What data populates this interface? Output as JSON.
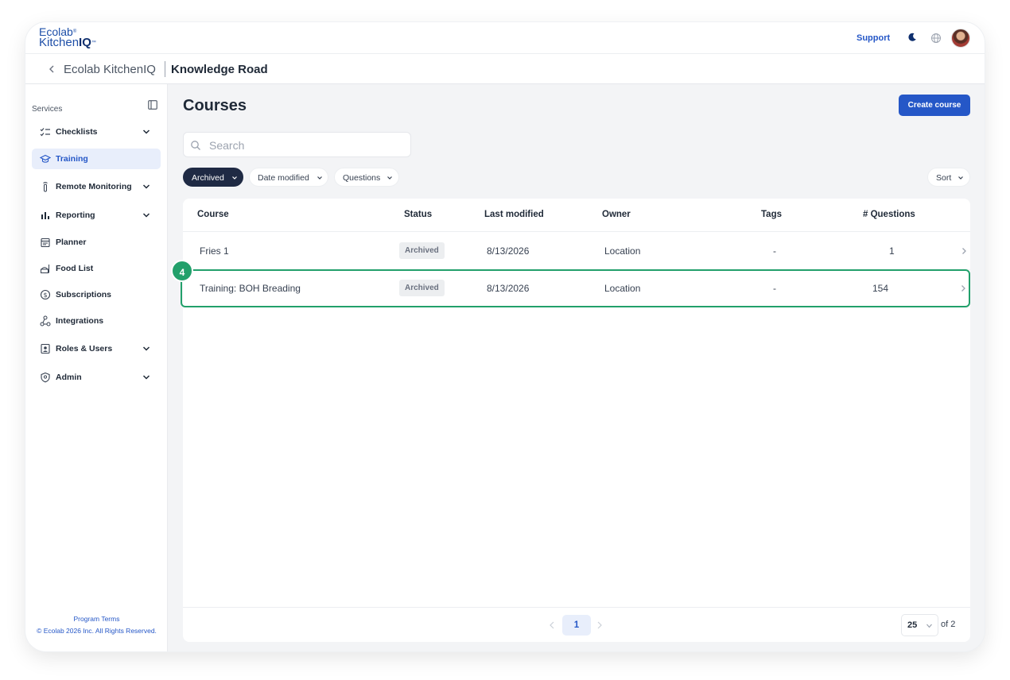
{
  "brand": {
    "line1": "Ecolab",
    "line1_mark": "®",
    "line2_prefix": "Kitchen",
    "line2_bold": "IQ",
    "line2_mark": "™"
  },
  "topbar": {
    "support_label": "Support",
    "icons": [
      "moon-icon",
      "globe-icon",
      "avatar"
    ]
  },
  "breadcrumb": {
    "parent": "Ecolab KitchenIQ",
    "current": "Knowledge Road"
  },
  "sidebar": {
    "section_label": "Services",
    "items": [
      {
        "label": "Checklists",
        "icon": "checklist-icon",
        "expandable": true,
        "active": false
      },
      {
        "label": "Training",
        "icon": "graduation-cap-icon",
        "expandable": false,
        "active": true
      },
      {
        "label": "Remote Monitoring",
        "icon": "thermometer-icon",
        "expandable": true,
        "active": false
      },
      {
        "label": "Reporting",
        "icon": "bar-chart-icon",
        "expandable": true,
        "active": false
      },
      {
        "label": "Planner",
        "icon": "calendar-icon",
        "expandable": false,
        "active": false
      },
      {
        "label": "Food List",
        "icon": "food-list-icon",
        "expandable": false,
        "active": false
      },
      {
        "label": "Subscriptions",
        "icon": "dollar-circle-icon",
        "expandable": false,
        "active": false
      },
      {
        "label": "Integrations",
        "icon": "integrations-icon",
        "expandable": false,
        "active": false
      },
      {
        "label": "Roles & Users",
        "icon": "id-badge-icon",
        "expandable": true,
        "active": false
      },
      {
        "label": "Admin",
        "icon": "shield-icon",
        "expandable": true,
        "active": false
      }
    ],
    "footer": {
      "terms": "Program Terms",
      "copyright": "© Ecolab 2026 Inc. All Rights Reserved."
    }
  },
  "main": {
    "title": "Courses",
    "create_button": "Create course",
    "search": {
      "placeholder": "Search",
      "value": ""
    },
    "filters": [
      {
        "label": "Archived",
        "selected": true
      },
      {
        "label": "Date modified",
        "selected": false
      },
      {
        "label": "Questions",
        "selected": false
      }
    ],
    "sort_label": "Sort",
    "table": {
      "columns": [
        "Course",
        "Status",
        "Last modified",
        "Owner",
        "Tags",
        "# Questions"
      ],
      "rows": [
        {
          "course": "Fries 1",
          "status": "Archived",
          "last_modified": "8/13/2026",
          "owner": "Location",
          "tags": "-",
          "questions": "1"
        },
        {
          "course": "Training: BOH Breading",
          "status": "Archived",
          "last_modified": "8/13/2026",
          "owner": "Location",
          "tags": "-",
          "questions": "154"
        }
      ],
      "highlighted_row_step": "4"
    },
    "pagination": {
      "current_page": "1",
      "per_page": "25",
      "of_label": "of 2"
    }
  },
  "colors": {
    "accent": "#2557c7",
    "highlight": "#22a06b",
    "chip_dark": "#1f2a44"
  }
}
